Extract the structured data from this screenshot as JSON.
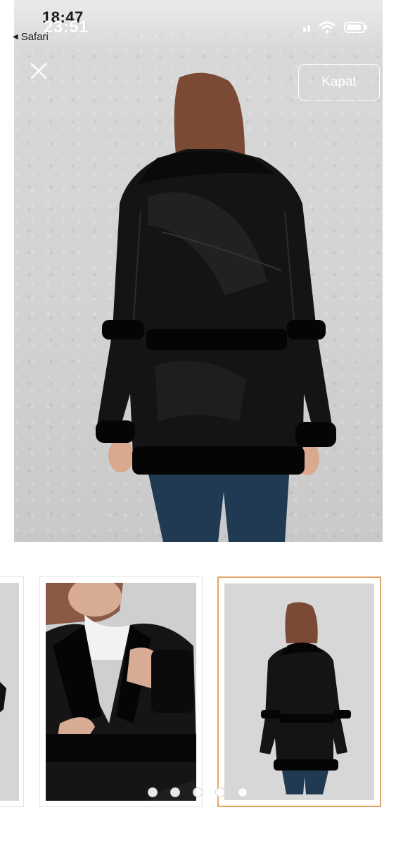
{
  "status_bar": {
    "time_primary": "18:47",
    "time_overlay": "23:51",
    "back_app_label": "Safari",
    "back_icon": "left-triangle-icon",
    "icons": [
      "signal-icon",
      "wifi-icon",
      "battery-icon"
    ]
  },
  "viewer": {
    "close_icon": "close-icon",
    "close_button_label": "Kapat"
  },
  "gallery": {
    "thumbnail_count_visible": 3,
    "active_index": 2,
    "dots": 5
  },
  "colors": {
    "active_border": "#e0a565",
    "overlay_text": "#ffffff"
  }
}
